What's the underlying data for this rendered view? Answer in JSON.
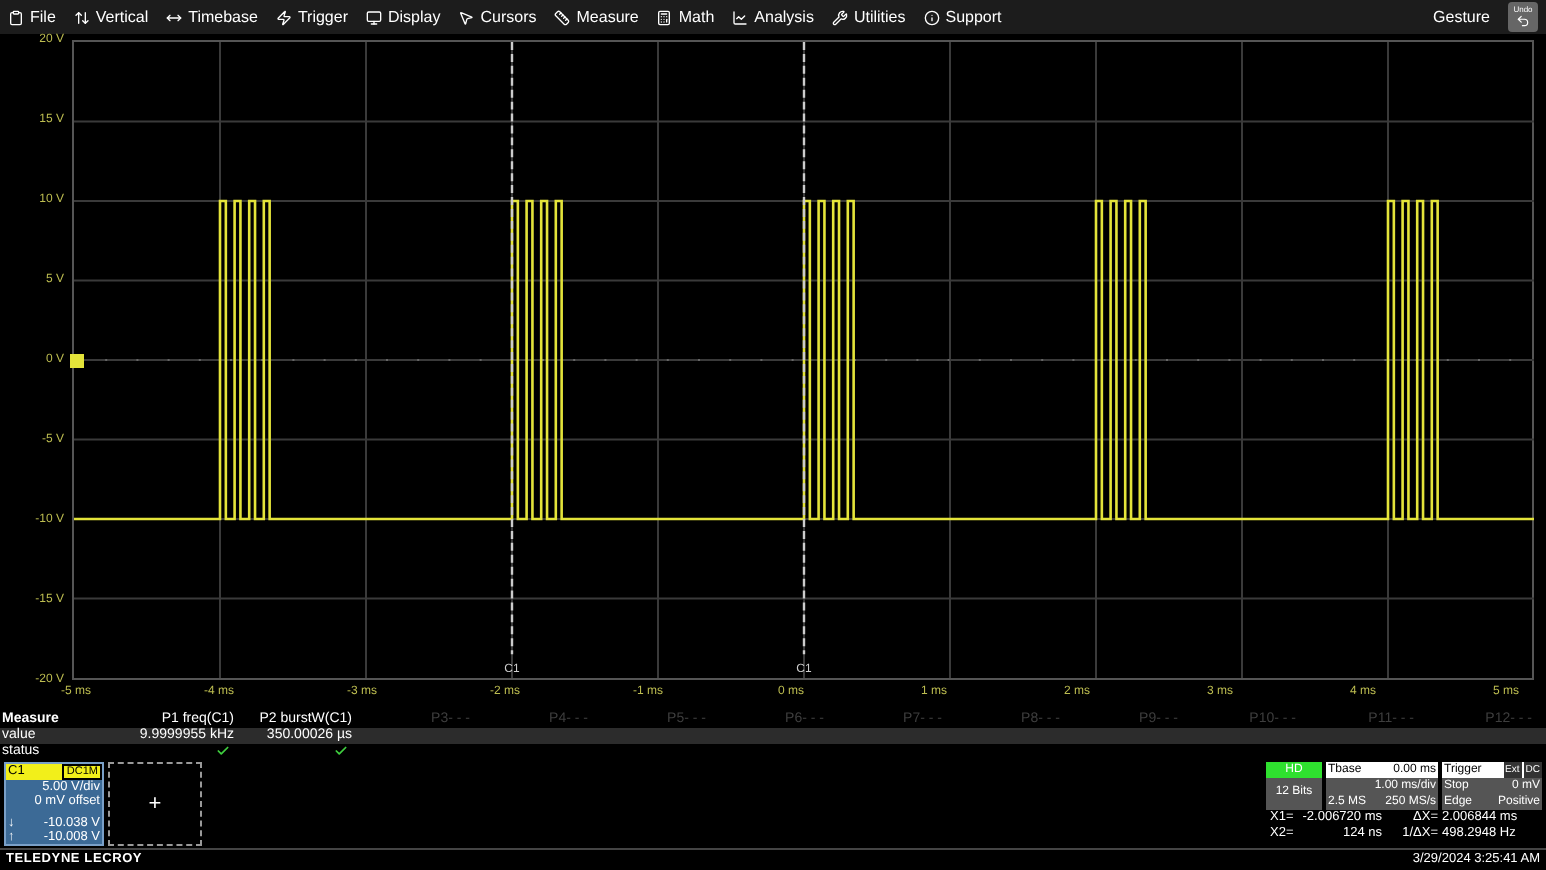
{
  "menu": [
    {
      "label": "File"
    },
    {
      "label": "Vertical"
    },
    {
      "label": "Timebase"
    },
    {
      "label": "Trigger"
    },
    {
      "label": "Display"
    },
    {
      "label": "Cursors"
    },
    {
      "label": "Measure"
    },
    {
      "label": "Math"
    },
    {
      "label": "Analysis"
    },
    {
      "label": "Utilities"
    },
    {
      "label": "Support"
    }
  ],
  "gesture": "Gesture",
  "undo": "Undo",
  "plot": {
    "y_labels": [
      "20 V",
      "15 V",
      "10 V",
      "5 V",
      "0 V",
      "-5 V",
      "-10 V",
      "-15 V",
      "-20 V"
    ],
    "x_labels": [
      "-5 ms",
      "-4 ms",
      "-3 ms",
      "-2 ms",
      "-1 ms",
      "0 ms",
      "1 ms",
      "2 ms",
      "3 ms",
      "4 ms",
      "5 ms"
    ],
    "cursors": [
      {
        "label": "C1"
      },
      {
        "label": "C1"
      }
    ]
  },
  "measure": {
    "title": "Measure",
    "row_labels": [
      "value",
      "status"
    ],
    "columns": [
      {
        "name": "P1 freq(C1)",
        "value": "9.9999955 kHz",
        "status_ok": true,
        "active": true
      },
      {
        "name": "P2 burstW(C1)",
        "value": "350.00026 µs",
        "status_ok": true,
        "active": true
      },
      {
        "name": "P3- - -",
        "active": false
      },
      {
        "name": "P4- - -",
        "active": false
      },
      {
        "name": "P5- - -",
        "active": false
      },
      {
        "name": "P6- - -",
        "active": false
      },
      {
        "name": "P7- - -",
        "active": false
      },
      {
        "name": "P8- - -",
        "active": false
      },
      {
        "name": "P9- - -",
        "active": false
      },
      {
        "name": "P10- - -",
        "active": false
      },
      {
        "name": "P11- - -",
        "active": false
      },
      {
        "name": "P12- - -",
        "active": false
      }
    ]
  },
  "channel": {
    "name": "C1",
    "coupling": "DC1M",
    "vdiv": "5.00 V/div",
    "offset": "0 mV offset",
    "min_symbol": "↓",
    "min": "-10.038 V",
    "max_symbol": "↑",
    "max": "-10.008 V"
  },
  "add_button": "+",
  "acquisition": {
    "mode": "HD",
    "bits": "12 Bits"
  },
  "timebase": {
    "title": "Tbase",
    "delay": "0.00 ms",
    "scale": "1.00 ms/div",
    "samples": "2.5 MS",
    "rate": "250 MS/s"
  },
  "trigger": {
    "title": "Trigger",
    "source": "Ext",
    "coupling": "DC",
    "mode": "Stop",
    "level_text": "0 mV",
    "type": "Edge",
    "slope": "Positive"
  },
  "cursor_readout": [
    {
      "label": "X1=",
      "value": "-2.006720 ms",
      "delta_label": "ΔX=",
      "delta": "2.006844 ms"
    },
    {
      "label": "X2=",
      "value": "124 ns",
      "delta_label": "1/ΔX=",
      "delta": "498.2948 Hz"
    }
  ],
  "footer": {
    "brand": "TELEDYNE LECROY",
    "timestamp": "3/29/2024 3:25:41 AM"
  }
}
